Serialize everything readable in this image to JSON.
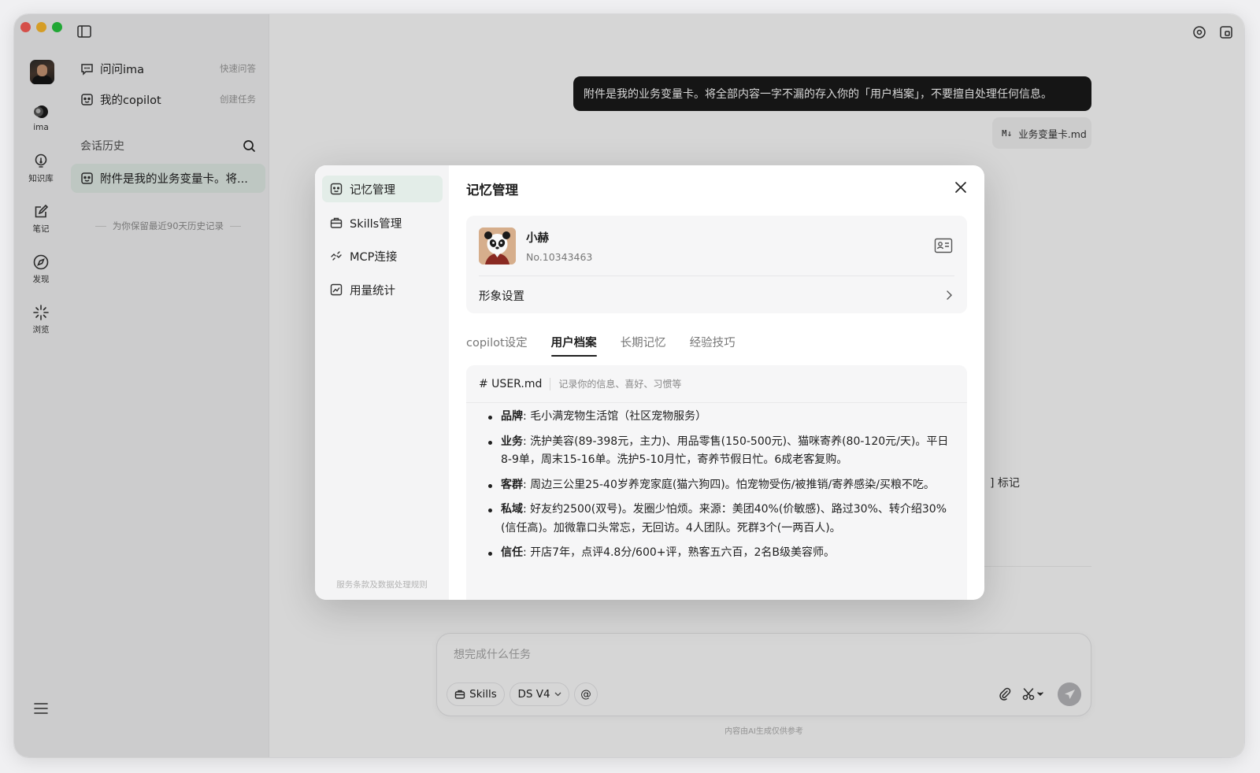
{
  "window": {
    "colors": {
      "close": "#fe5f57",
      "minimize": "#febc2e",
      "zoom": "#28c840",
      "active_bg": "#e3ede8"
    }
  },
  "rail": {
    "items": [
      {
        "icon": "ima-logo-icon",
        "label": "ima"
      },
      {
        "icon": "lightbulb-icon",
        "label": "知识库"
      },
      {
        "icon": "edit-note-icon",
        "label": "笔记"
      },
      {
        "icon": "compass-icon",
        "label": "发现"
      },
      {
        "icon": "sparkle-icon",
        "label": "浏览"
      }
    ]
  },
  "sidebar": {
    "top_items": [
      {
        "label": "问问ima",
        "hint": "快速问答",
        "icon": "chat-icon"
      },
      {
        "label": "我的copilot",
        "hint": "创建任务",
        "icon": "copilot-icon"
      }
    ],
    "history_title": "会话历史",
    "history_items": [
      {
        "label": "附件是我的业务变量卡。将..."
      }
    ],
    "retention_note": "为你保留最近90天历史记录"
  },
  "chat": {
    "user_message": "附件是我的业务变量卡。将全部内容一字不漏的存入你的「用户档案」，不要擅自处理任何信息。",
    "attachment": {
      "badge": "M↓",
      "name": "业务变量卡.md"
    },
    "partial_text": "] 标记",
    "composer": {
      "placeholder": "想完成什么任务",
      "skills_label": "Skills",
      "model_label": "DS V4",
      "at_label": "@"
    },
    "footer_note": "内容由AI生成仅供参考"
  },
  "modal": {
    "title": "记忆管理",
    "nav": [
      {
        "label": "记忆管理",
        "icon": "memory-icon",
        "active": true
      },
      {
        "label": "Skills管理",
        "icon": "toolbox-icon",
        "active": false
      },
      {
        "label": "MCP连接",
        "icon": "link-icon",
        "active": false
      },
      {
        "label": "用量统计",
        "icon": "stats-icon",
        "active": false
      }
    ],
    "nav_footer": "服务条款及数据处理规则",
    "profile": {
      "name": "小赫",
      "number": "No.10343463",
      "appearance_label": "形象设置"
    },
    "tabs": [
      {
        "label": "copilot设定",
        "active": false
      },
      {
        "label": "用户档案",
        "active": true
      },
      {
        "label": "长期记忆",
        "active": false
      },
      {
        "label": "经验技巧",
        "active": false
      }
    ],
    "doc": {
      "filename": "# USER.md",
      "description": "记录你的信息、喜好、习惯等",
      "items": [
        {
          "key": "品牌",
          "text": ": 毛小满宠物生活馆（社区宠物服务）"
        },
        {
          "key": "业务",
          "text": ": 洗护美容(89-398元，主力)、用品零售(150-500元)、猫咪寄养(80-120元/天)。平日8-9单，周末15-16单。洗护5-10月忙，寄养节假日忙。6成老客复购。"
        },
        {
          "key": "客群",
          "text": ": 周边三公里25-40岁养宠家庭(猫六狗四)。怕宠物受伤/被推销/寄养感染/买粮不吃。"
        },
        {
          "key": "私域",
          "text": ": 好友约2500(双号)。发圈少怕烦。来源：美团40%(价敏感)、路过30%、转介绍30%(信任高)。加微靠口头常忘，无回访。4人团队。死群3个(一两百人)。"
        },
        {
          "key": "信任",
          "text": ": 开店7年，点评4.8分/600+评，熟客五六百，2名B级美容师。"
        }
      ]
    }
  }
}
